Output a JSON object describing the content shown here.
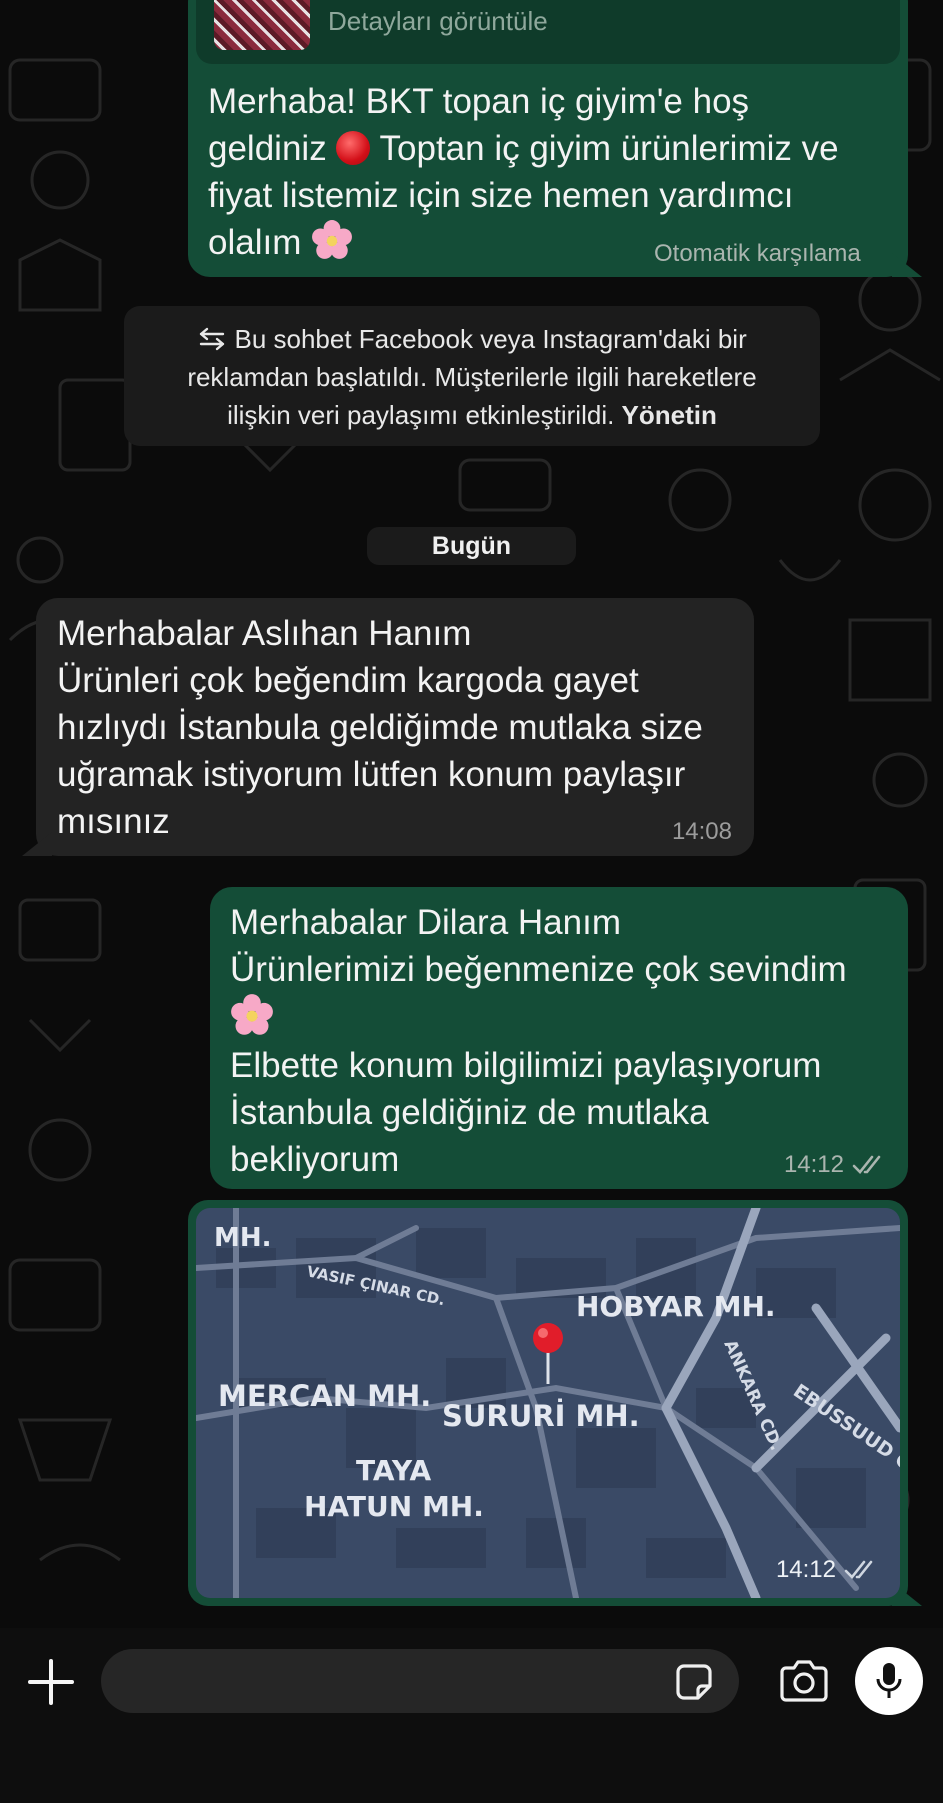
{
  "preview": {
    "label": "Detayları görüntüle"
  },
  "messages": {
    "welcome": {
      "text_part1": "Merhaba! BKT topan iç giyim'e hoş\ngeldiniz ",
      "text_part2": " Toptan iç giyim ürünlerimiz ve\nfiyat listemiz için size hemen yardımcı\nolalım ",
      "footer": "Otomatik karşılama"
    },
    "system_notice": {
      "text": "Bu sohbet Facebook veya Instagram'daki bir\nreklamdan başlatıldı. Müşterilerle ilgili hareketlere\nilişkin veri paylaşımı etkinleştirildi. ",
      "action": "Yönetin"
    },
    "date_divider": "Bugün",
    "incoming": {
      "text": "Merhabalar Aslıhan Hanım\nÜrünleri çok beğendim kargoda gayet\nhızlıydı  İstanbula geldiğimde mutlaka size\nuğramak istiyorum lütfen konum paylaşır\nmısınız",
      "time": "14:08"
    },
    "reply": {
      "text_part1": "Merhabalar Dilara Hanım\nÜrünlerimizi beğenmenize çok sevindim\n",
      "text_part2": "\nElbette konum bilgilimizi paylaşıyorum\nİstanbula geldiğiniz de mutlaka\nbekliyorum",
      "time": "14:12",
      "status": "read"
    },
    "location": {
      "time": "14:12",
      "status": "read",
      "labels": {
        "top": "MH.",
        "street1": "VASIF ÇINAR CD.",
        "hobyar": "HOBYAR MH.",
        "mercan": "MERCAN MH.",
        "sururi": "SURURİ MH.",
        "taya1": "TAYA",
        "taya2": "HATUN MH.",
        "ankara": "ANKARA CD.",
        "ebussuud": "EBUSSUUD C"
      }
    }
  },
  "composer": {
    "placeholder": ""
  },
  "icons": {
    "plus": "plus-icon",
    "sticker": "sticker-icon",
    "camera": "camera-icon",
    "mic": "microphone-icon"
  },
  "colors": {
    "outgoing_bubble": "#144d37",
    "incoming_bubble": "#232323",
    "background": "#0b0b0b",
    "map_background": "#3a4a66",
    "pin": "#e11d2a"
  }
}
